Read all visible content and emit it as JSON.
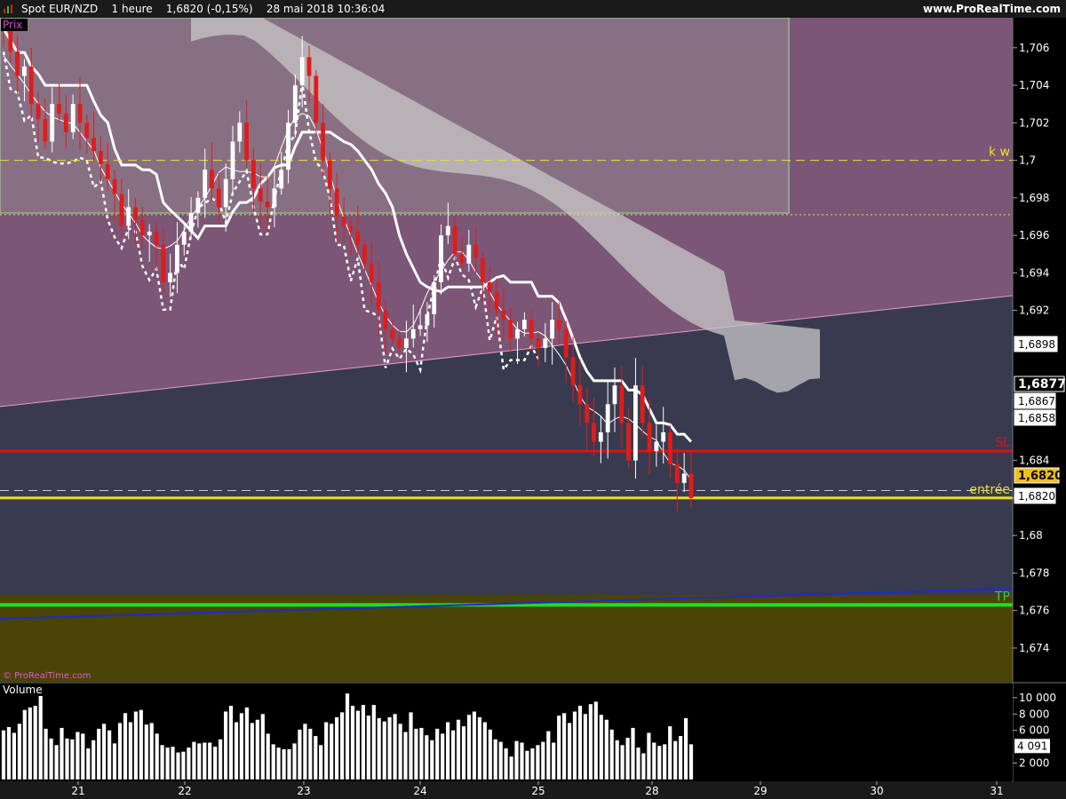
{
  "header": {
    "instrument": "Spot EUR/NZD",
    "timeframe": "1 heure",
    "price_change": "1,6820 (-0,15%)",
    "timestamp": "28 mai 2018 10:36:04",
    "website": "www.ProRealTime.com"
  },
  "price_panel_label": "Prix",
  "watermark": "© ProRealTime.com",
  "volume_panel_label": "Volume",
  "colors": {
    "bg_top": "#7b5676",
    "bg_mid": "#383b4f",
    "bg_bottom": "#4a4406",
    "up": "#ffffff",
    "down": "#e21b1b",
    "sl": "#e01010",
    "tp": "#22dd22",
    "entry": "#f0e020",
    "kw": "#f0e020",
    "cloud": "#c8c8c8",
    "trend": "#1c2bd0"
  },
  "chart_data": [
    {
      "type": "candlestick",
      "title": "Spot EUR/NZD 1 heure",
      "x_tick_labels": [
        "21",
        "22",
        "23",
        "24",
        "25",
        "28",
        "29",
        "30",
        "31"
      ],
      "y_tick_labels": [
        "1,706",
        "1,704",
        "1,702",
        "1,7",
        "1,698",
        "1,696",
        "1,694",
        "1,692",
        "1,684",
        "1,682",
        "1,68",
        "1,678",
        "1,676",
        "1,674"
      ],
      "ylim": [
        1.6722,
        1.7076
      ],
      "price_tags": [
        {
          "label": "1,6898",
          "value": 1.6898
        },
        {
          "label": "1,6877",
          "value": 1.6877
        },
        {
          "label": "1,6867",
          "value": 1.6867
        },
        {
          "label": "1,6858",
          "value": 1.6858
        },
        {
          "label": "1,6820",
          "value": 1.6824
        },
        {
          "label": "1,6820",
          "value": 1.682
        }
      ],
      "levels": [
        {
          "label": "k w",
          "value": 1.7
        },
        {
          "label": "SL",
          "value": 1.6845
        },
        {
          "label": "entrée",
          "value": 1.682
        },
        {
          "label": "TP",
          "value": 1.6763
        }
      ],
      "close_path": [
        1.707,
        1.7058,
        1.7045,
        1.705,
        1.703,
        1.7022,
        1.701,
        1.703,
        1.7025,
        1.7015,
        1.703,
        1.702,
        1.7012,
        1.7005,
        1.6998,
        1.699,
        1.6982,
        1.6965,
        1.6975,
        1.6968,
        1.696,
        1.6962,
        1.6955,
        1.6935,
        1.694,
        1.6955,
        1.6962,
        1.6972,
        1.698,
        1.6995,
        1.6985,
        1.6975,
        1.699,
        1.701,
        1.702,
        1.7,
        1.6985,
        1.6978,
        1.6975,
        1.6985,
        1.6995,
        1.702,
        1.704,
        1.7055,
        1.7045,
        1.702,
        1.7,
        1.6985,
        1.697,
        1.6965,
        1.6962,
        1.6955,
        1.6945,
        1.6935,
        1.692,
        1.691,
        1.6905,
        1.69,
        1.6905,
        1.691,
        1.6912,
        1.6918,
        1.6935,
        1.696,
        1.6965,
        1.695,
        1.6945,
        1.6955,
        1.6948,
        1.6935,
        1.693,
        1.692,
        1.6915,
        1.6905,
        1.691,
        1.6915,
        1.6905,
        1.69,
        1.6905,
        1.6915,
        1.691,
        1.6895,
        1.688,
        1.687,
        1.686,
        1.685,
        1.6855,
        1.687,
        1.688,
        1.686,
        1.684,
        1.688,
        1.686,
        1.6845,
        1.685,
        1.6855,
        1.6838,
        1.6828,
        1.6833,
        1.682
      ],
      "volume": {
        "y_tick_labels": [
          "10 000",
          "8 000",
          "6 000",
          "2 000"
        ],
        "last_label": "4 091",
        "last_value": 4091,
        "ylim": [
          0,
          11500
        ],
        "values": [
          6000,
          6400,
          5700,
          6800,
          8500,
          8800,
          9000,
          10200,
          6200,
          5000,
          4200,
          6300,
          5000,
          4900,
          5800,
          5600,
          3800,
          4800,
          6200,
          6800,
          6000,
          4400,
          6900,
          8100,
          7000,
          8300,
          8500,
          6700,
          6900,
          5600,
          4200,
          3900,
          4000,
          3300,
          3400,
          3900,
          4600,
          4400,
          4500,
          4500,
          4000,
          4900,
          8300,
          9000,
          7000,
          8100,
          8800,
          6900,
          7300,
          8000,
          5600,
          4300,
          3900,
          3700,
          3700,
          4400,
          6100,
          6800,
          6200,
          5300,
          4200,
          7000,
          6800,
          7600,
          8200,
          10500,
          9000,
          8400,
          9100,
          7800,
          9100,
          7500,
          7100,
          7600,
          8000,
          6800,
          5800,
          8200,
          6200,
          6300,
          5400,
          4800,
          6200,
          5600,
          7000,
          6000,
          7300,
          6500,
          7900,
          8300,
          7600,
          7000,
          6100,
          4900,
          4600,
          3800,
          2800,
          4700,
          4500,
          3500,
          3800,
          4200,
          4600,
          5900,
          4500,
          7800,
          8100,
          6900,
          8300,
          9000,
          8000,
          9200,
          9500,
          7900,
          7300,
          6100,
          4800,
          4200,
          5100,
          6300,
          3900,
          3200,
          5700,
          4500,
          4100,
          4300,
          6500,
          4700,
          5300,
          7500,
          4300
        ]
      }
    }
  ]
}
